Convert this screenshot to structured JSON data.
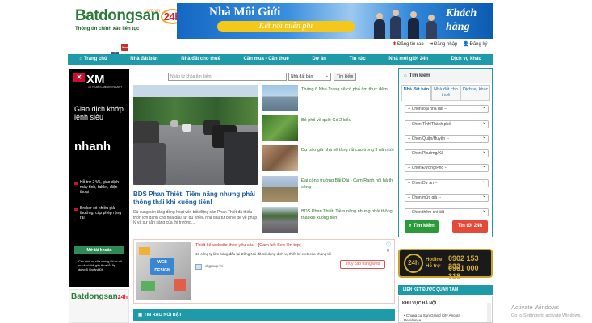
{
  "header": {
    "logo_main": "Batdongsan",
    "logo_24": "24h",
    "logo_domain": ".com.vn",
    "logo_tagline": "Thông tin chính xác liên tục",
    "social": [
      "f",
      "You Tube"
    ],
    "banner": {
      "title": "Nhà Môi Giới",
      "subtitle": "Kết nối miễn phí",
      "right_line1": "Khách",
      "right_line2": "hàng"
    },
    "account": {
      "post": "Đăng tin rao",
      "login": "Đăng nhập",
      "register": "Đăng ký"
    }
  },
  "nav": {
    "items": [
      "Trang chủ",
      "Nhà đất bán",
      "Nhà đất cho thuê",
      "Cần mua - Cần thuê",
      "Dự án",
      "Tin tức",
      "Nhà môi giới 24h",
      "Dịch vụ khác"
    ]
  },
  "left_ad": {
    "brand": "XM",
    "brand_sub": "10 YEARS ANNIVERSARY",
    "line1": "Giao dịch khớp lệnh siêu",
    "line2": "nhanh",
    "bullets": [
      "Hỗ trợ 24/5, giao dịch máy tính, tablet, điện thoại",
      "Broker có nhiều giải thưởng, cấp phép rộng rãi"
    ],
    "button": "Mở tài khoản",
    "footer": "Các dịch vụ của chúng tôi có rủi ro và có thể gây thua lỗ. Áp dụng Đ khoản&ĐK"
  },
  "left_logo2": {
    "text": "Batdongsan",
    "n24": "24h"
  },
  "search": {
    "placeholder": "Nhập từ khóa tìm kiếm",
    "type": "Nhà đất bán",
    "button": "Tìm kiếm"
  },
  "featured": {
    "title": "BDS Phan Thiết: Tiềm năng nhưng phải thông thái khi xuống tiền!",
    "summary": "Dù cung còn tăng đồng hoạt vốn bất động sản Phan Thiết đã thiếu thốn lớn dành cho nhà đầu tư, dù nhiều nhà đầu tư còn e dè về pháp lý và sự sẵn sàng của thị trường..."
  },
  "news": [
    "Tháng 6 Nha Trang sẽ có phố ẩm thực đêm",
    "Bỏ phố về quê: Có 2 kiểu",
    "Dự báo giá nhà sẽ tăng rất cao trong 3 năm tới",
    "Đại công trường Bãi Dài - Cam Ranh hồi hả thi công",
    "BDS Phan Thiết: Tiềm năng nhưng phải thông thái khi xuống tiền!"
  ],
  "mid_ad": {
    "title": "Thiết kế website theo yêu cầu - [Cam kết Seo lên top]",
    "desc": "10 công ty làm hàng đầu tại Đồng Nai đã sử dụng dịch vụ thiết kế web của chúng tôi",
    "url": "cltgroup.vn",
    "button": "Truy cập trang web",
    "close": "ⓘ ✕"
  },
  "tin_rao": "TIN RAO NỔI BẬT",
  "right_panel": {
    "title": "Tìm kiếm",
    "tabs": [
      "Nhà đất bán",
      "Nhà đất cho thuê",
      "Dịch vụ khác"
    ],
    "selects": [
      "-- Chọn loại nhà đất --",
      "-- Chọn Tỉnh/Thành phố --",
      "-- Chọn Quận/Huyện --",
      "-- Chọn Phường/Xã --",
      "-- Chọn Đường/Phố --",
      "-- Chọn Dự án --",
      "-- Chọn mức giá --",
      "-- Chọn thêm chi tiết --"
    ],
    "btn_search": "Tìm kiếm",
    "btn_24": "Tin tốt 24h"
  },
  "hotline": {
    "logo": "24h",
    "label1": "Hotline",
    "label2": "Hỗ trợ",
    "num1": "0902 153 233",
    "num2": "0961 000 318"
  },
  "lien_ket": {
    "title": "LIÊN KẾT ĐƯỢC QUAN TÂM",
    "heading": "KHU VỰC HÀ NỘI",
    "items": [
      "• Chung cư Sun Grand City Ancora",
      "Residence"
    ]
  },
  "windows": {
    "line1": "Activate Windows",
    "line2": "Go to Settings to activate Windows."
  }
}
